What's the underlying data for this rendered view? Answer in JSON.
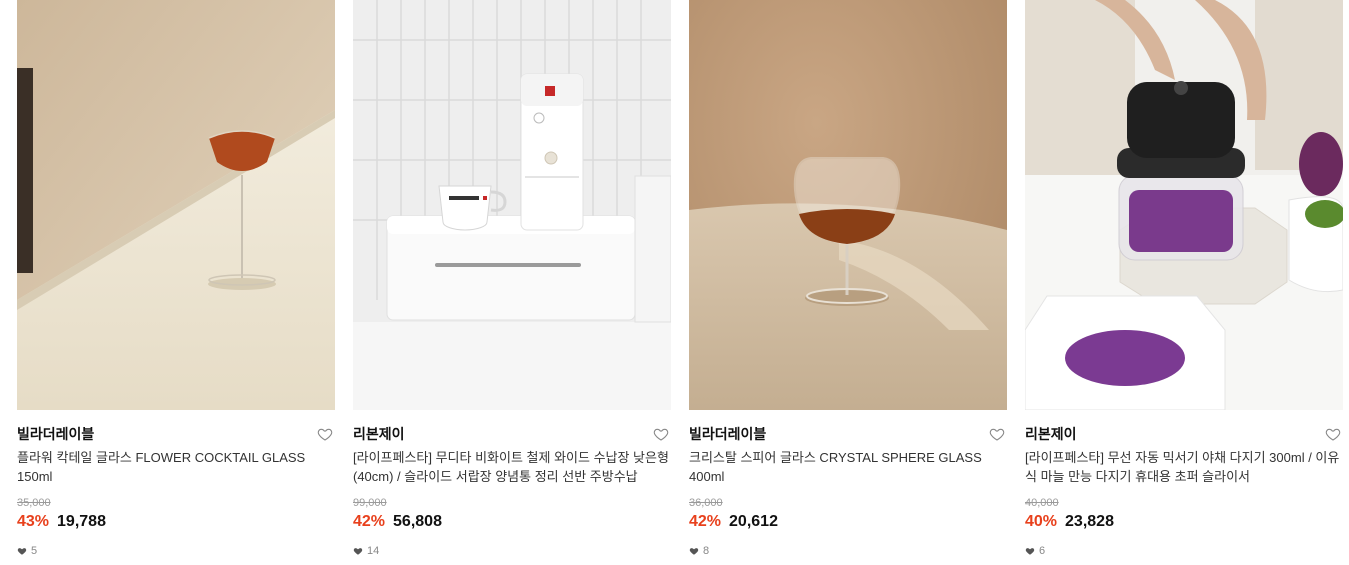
{
  "products": [
    {
      "brand": "빌라더레이블",
      "title": "플라워 칵테일 글라스 FLOWER COCKTAIL GLASS 150ml",
      "original_price": "35,000",
      "discount": "43%",
      "price": "19,788",
      "likes": "5"
    },
    {
      "brand": "리본제이",
      "title": "[라이프페스타] 무디타 비화이트 철제 와이드 수납장 낮은형 (40cm) / 슬라이드 서랍장 양념통 정리 선반 주방수납",
      "original_price": "99,000",
      "discount": "42%",
      "price": "56,808",
      "likes": "14"
    },
    {
      "brand": "빌라더레이블",
      "title": "크리스탈 스피어 글라스 CRYSTAL SPHERE GLASS 400ml",
      "original_price": "36,000",
      "discount": "42%",
      "price": "20,612",
      "likes": "8"
    },
    {
      "brand": "리본제이",
      "title": "[라이프페스타] 무선 자동 믹서기 야채 다지기 300ml / 이유식 마늘 만능 다지기 휴대용 초퍼 슬라이서",
      "original_price": "40,000",
      "discount": "40%",
      "price": "23,828",
      "likes": "6"
    }
  ],
  "colors": {
    "discount": "#e8401c",
    "strike": "#9a9a9a"
  },
  "icons": {
    "wishlist": "heart-outline-icon",
    "likes": "heart-filled-icon"
  }
}
